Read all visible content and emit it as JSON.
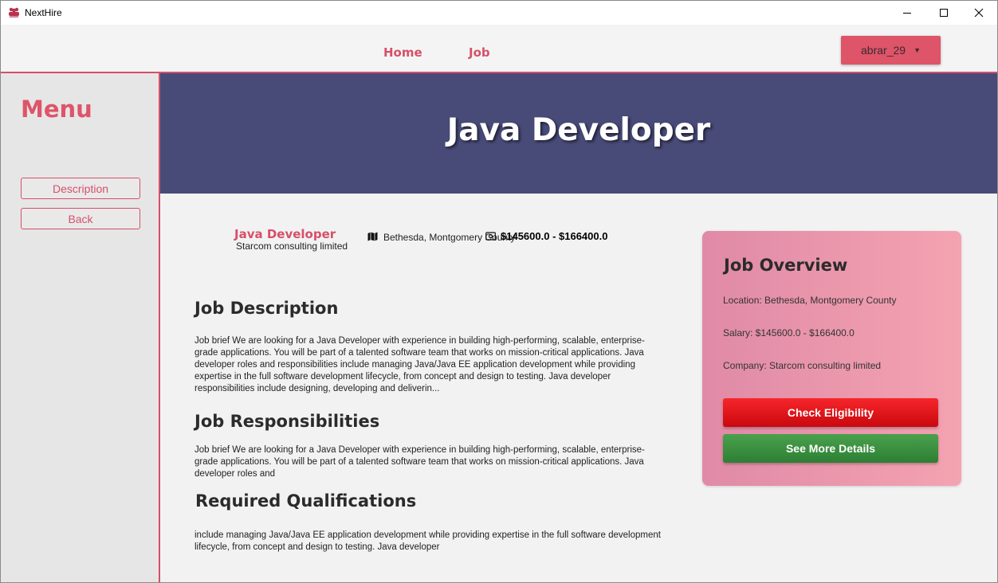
{
  "window": {
    "title": "NextHire",
    "controls": {
      "minimize": "—",
      "maximize": "☐",
      "close": "✕"
    }
  },
  "topnav": {
    "links": [
      "Home",
      "Job"
    ],
    "user": {
      "name": "abrar_29",
      "caret": "▼"
    }
  },
  "sidebar": {
    "title": "Menu",
    "buttons": [
      "Description",
      "Back"
    ]
  },
  "banner": {
    "title": "Java Developer"
  },
  "job": {
    "name": "Java Developer",
    "company": "Starcom consulting limited",
    "location": "Bethesda, Montgomery County",
    "salary": "$145600.0 - $166400.0"
  },
  "sections": {
    "description": {
      "heading": "Job Description",
      "body": "Job brief We are looking for a Java Developer with experience in building high-performing, scalable, enterprise-grade applications. You will be part of a talented software team that works on mission-critical applications. Java developer roles and responsibilities include managing Java/Java EE application development while providing expertise in the full software development lifecycle, from concept and design to testing. Java developer responsibilities include designing, developing and deliverin..."
    },
    "responsibilities": {
      "heading": "Job Responsibilities",
      "body": "Job brief We are looking for a Java Developer with experience in building high-performing, scalable, enterprise-grade applications. You will be part of a talented software team that works on mission-critical applications. Java developer roles and"
    },
    "qualifications": {
      "heading": "Required Qualifications",
      "body": "include managing Java/Java EE application development while providing expertise in the full software development lifecycle, from concept and design to testing. Java developer"
    }
  },
  "overview": {
    "title": "Job Overview",
    "location": "Location: Bethesda, Montgomery County",
    "salary": "Salary: $145600.0 - $166400.0",
    "company": "Company: Starcom consulting limited",
    "check_button": "Check Eligibility",
    "details_button": "See More Details"
  },
  "colors": {
    "accent": "#d6506a",
    "banner": "#484a78",
    "eligibility": "#e01419",
    "details": "#3b8f40"
  },
  "icons": [
    "app-logo-icon",
    "map-icon",
    "money-icon",
    "chevron-down-icon"
  ]
}
